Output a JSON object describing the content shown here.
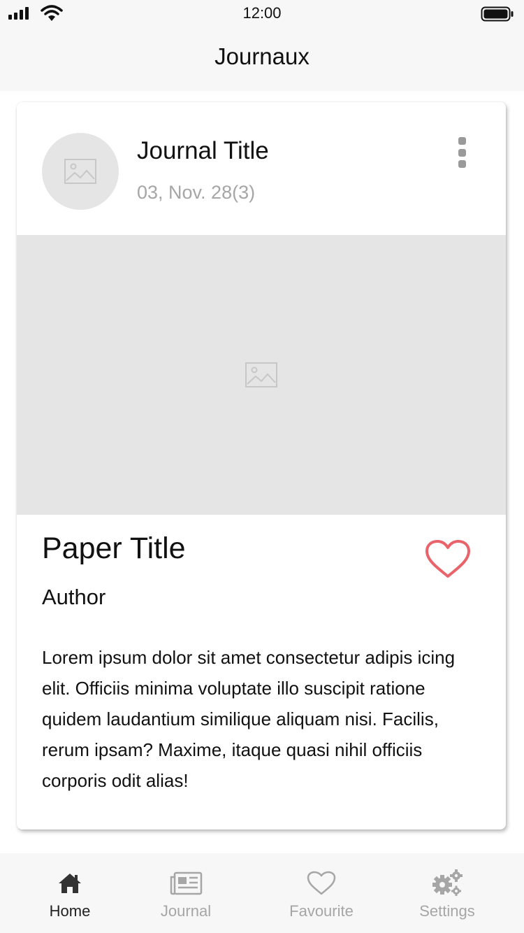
{
  "status_bar": {
    "time": "12:00"
  },
  "nav": {
    "title": "Journaux"
  },
  "card": {
    "journal_title": "Journal Title",
    "journal_date": "03, Nov. 28(3)",
    "paper_title": "Paper Title",
    "author": "Author",
    "abstract": "Lorem ipsum dolor sit amet consectetur adipis icing elit. Officiis minima voluptate illo suscipit ratione quidem laudantium similique aliquam nisi. Facilis, rerum ipsam? Maxime, itaque quasi nihil officiis corporis odit alias!",
    "favorite_icon": "heart-outline-icon",
    "more_icon": "more-vertical-icon"
  },
  "tabs": [
    {
      "label": "Home",
      "icon": "home-icon",
      "active": true
    },
    {
      "label": "Journal",
      "icon": "newspaper-icon",
      "active": false
    },
    {
      "label": "Favourite",
      "icon": "heart-icon",
      "active": false
    },
    {
      "label": "Settings",
      "icon": "gears-icon",
      "active": false
    }
  ],
  "colors": {
    "accent_heart": "#e8646a",
    "placeholder": "#e5e5e5",
    "muted_text": "#a6a6a6",
    "bar_background": "#f7f7f7"
  }
}
